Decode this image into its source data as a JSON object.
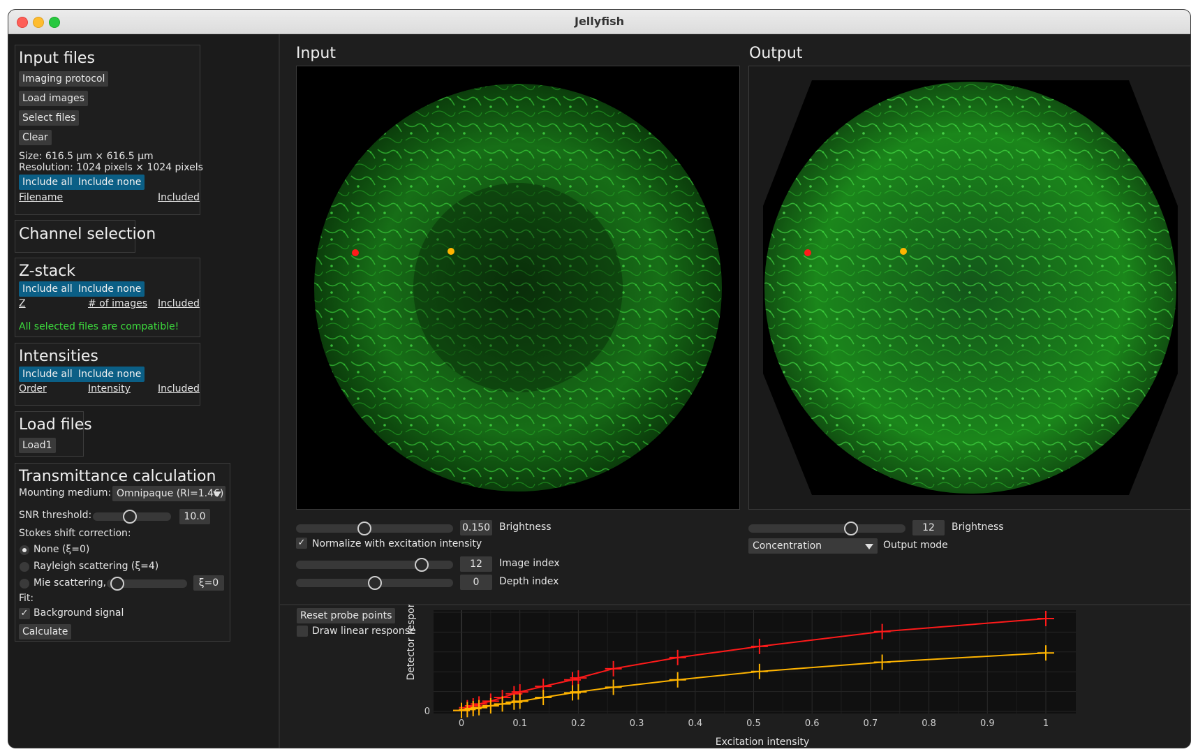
{
  "window": {
    "title": "Jellyfish"
  },
  "colors": {
    "accent_blue": "#0b5f86",
    "probe_red": "#ff1a1a",
    "probe_orange": "#ffb400",
    "compatible_green": "#3ddc3d"
  },
  "input_files": {
    "heading": "Input files",
    "buttons": [
      "Imaging protocol",
      "Load images",
      "Select files",
      "Clear"
    ],
    "size": "Size: 616.5 μm × 616.5 μm",
    "resolution": "Resolution: 1024 pixels × 1024 pixels",
    "include_all": "Include all",
    "include_none": "Include none",
    "col_filename": "Filename",
    "col_included": "Included"
  },
  "channel_selection": {
    "heading": "Channel selection"
  },
  "zstack": {
    "heading": "Z-stack",
    "include_all": "Include all",
    "include_none": "Include none",
    "col_z": "Z",
    "col_images": "# of images",
    "col_included": "Included",
    "status": "All selected files are compatible!"
  },
  "intensities": {
    "heading": "Intensities",
    "include_all": "Include all",
    "include_none": "Include none",
    "col_order": "Order",
    "col_intensity": "Intensity",
    "col_included": "Included"
  },
  "load_files": {
    "heading": "Load files",
    "button": "Load1"
  },
  "transmittance": {
    "heading": "Transmittance calculation",
    "mounting_label": "Mounting medium:",
    "mounting_value": "Omnipaque (RI=1.46)",
    "snr_label": "SNR threshold:",
    "snr_value": "10.0",
    "snr_level": 0.47,
    "stokes_label": "Stokes shift correction:",
    "opt_none": "None (ξ=0)",
    "opt_rayleigh": "Rayleigh scattering (ξ=4)",
    "opt_mie": "Mie scattering,",
    "mie_value": "ξ=0",
    "mie_level": 0.05,
    "fit_label": "Fit:",
    "background_label": "Background signal",
    "background_checked": true,
    "calc_button": "Calculate"
  },
  "input_view": {
    "label": "Input",
    "brightness_value": "0.150",
    "brightness_label": "Brightness",
    "brightness_level": 0.43,
    "normalize_label": "Normalize with excitation intensity",
    "normalize_checked": true,
    "image_index_value": "12",
    "image_index_label": "Image index",
    "image_index_level": 0.83,
    "depth_index_value": "0",
    "depth_index_label": "Depth index",
    "depth_index_level": 0.5
  },
  "output_view": {
    "label": "Output",
    "brightness_value": "12",
    "brightness_label": "Brightness",
    "brightness_level": 0.67,
    "mode_value": "Concentration",
    "mode_label": "Output mode"
  },
  "probe": {
    "reset_button": "Reset probe points",
    "draw_linear_label": "Draw linear response",
    "draw_linear_checked": false
  },
  "chart_data": {
    "type": "line",
    "xlabel": "Excitation intensity",
    "ylabel": "Detector response",
    "xlim": [
      0,
      1
    ],
    "x_ticks": [
      "0",
      "0.1",
      "0.2",
      "0.3",
      "0.4",
      "0.5",
      "0.6",
      "0.7",
      "0.8",
      "0.9",
      "1"
    ],
    "y_ticks": [
      "0"
    ],
    "grid": true,
    "series": [
      {
        "color": "#ff1a1a",
        "x": [
          0,
          0.01,
          0.02,
          0.03,
          0.05,
          0.07,
          0.09,
          0.1,
          0.14,
          0.19,
          0.2,
          0.26,
          0.37,
          0.51,
          0.72,
          1.0
        ],
        "y": [
          0.01,
          0.04,
          0.06,
          0.08,
          0.11,
          0.15,
          0.19,
          0.21,
          0.27,
          0.34,
          0.36,
          0.46,
          0.58,
          0.7,
          0.86,
          1.0
        ]
      },
      {
        "color": "#ffb400",
        "x": [
          0,
          0.01,
          0.02,
          0.03,
          0.05,
          0.07,
          0.09,
          0.1,
          0.14,
          0.19,
          0.2,
          0.26,
          0.37,
          0.51,
          0.72,
          1.0
        ],
        "y": [
          0.01,
          0.02,
          0.03,
          0.04,
          0.06,
          0.08,
          0.1,
          0.11,
          0.15,
          0.2,
          0.21,
          0.26,
          0.34,
          0.43,
          0.53,
          0.63
        ]
      }
    ]
  }
}
